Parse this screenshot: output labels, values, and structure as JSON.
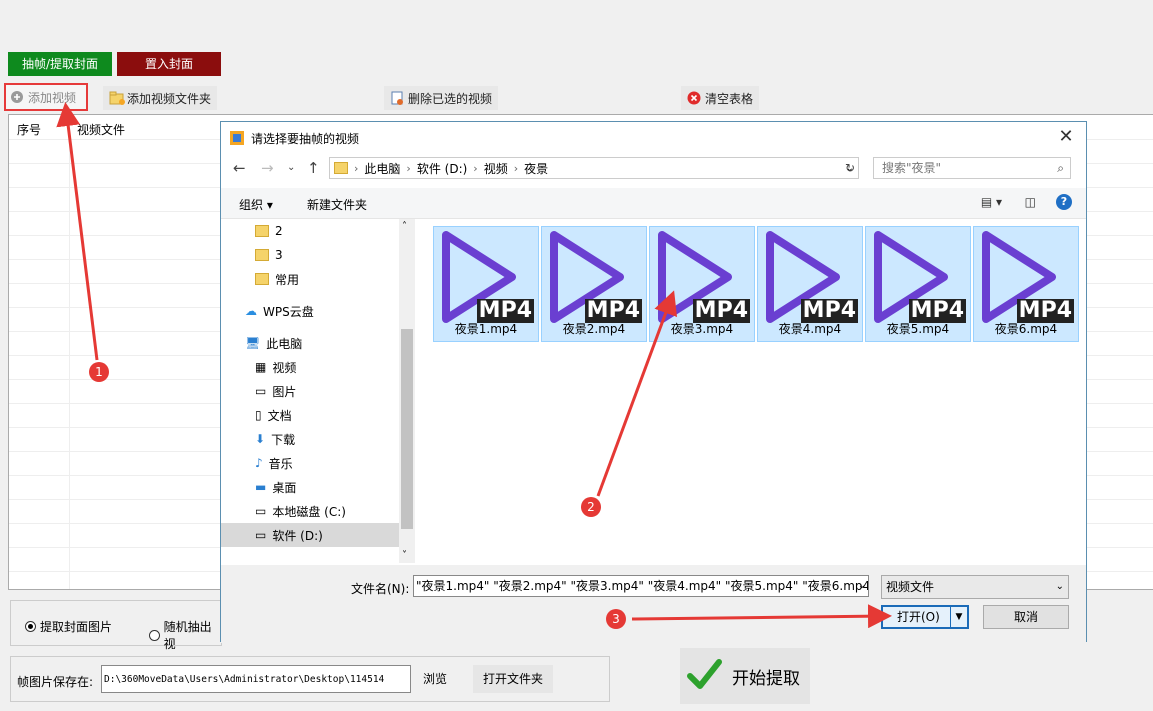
{
  "top_buttons": {
    "extract": "抽帧/提取封面",
    "insert": "置入封面"
  },
  "toolbar": {
    "add_video": "添加视频",
    "add_folder": "添加视频文件夹",
    "delete_selected": "删除已选的视频",
    "clear_table": "清空表格"
  },
  "grid": {
    "col_index": "序号",
    "col_file": "视频文件"
  },
  "options": {
    "extract_cover": "提取封面图片",
    "random_frame": "随机抽出视"
  },
  "save": {
    "label": "帧图片保存在:",
    "path": "D:\\360MoveData\\Users\\Administrator\\Desktop\\114514",
    "browse": "浏览",
    "open_folder": "打开文件夹"
  },
  "start_button": "开始提取",
  "dialog": {
    "title": "请选择要抽帧的视频",
    "close": "✕",
    "breadcrumb": [
      "此电脑",
      "软件 (D:)",
      "视频",
      "夜景"
    ],
    "search_placeholder": "搜索\"夜景\"",
    "organize": "组织",
    "new_folder": "新建文件夹",
    "help": "?",
    "nav_items": [
      {
        "label": "2",
        "icon": "folder-icon"
      },
      {
        "label": "3",
        "icon": "folder-icon"
      },
      {
        "label": "常用",
        "icon": "folder-icon"
      },
      {
        "label": "WPS云盘",
        "icon": "cloud-icon"
      },
      {
        "label": "此电脑",
        "icon": "computer-icon"
      },
      {
        "label": "视频",
        "icon": "video-icon"
      },
      {
        "label": "图片",
        "icon": "picture-icon"
      },
      {
        "label": "文档",
        "icon": "document-icon"
      },
      {
        "label": "下载",
        "icon": "download-icon"
      },
      {
        "label": "音乐",
        "icon": "music-icon"
      },
      {
        "label": "桌面",
        "icon": "desktop-icon"
      },
      {
        "label": "本地磁盘 (C:)",
        "icon": "drive-icon"
      },
      {
        "label": "软件 (D:)",
        "icon": "drive-icon"
      }
    ],
    "files": [
      {
        "name": "夜景1.mp4",
        "badge": "MP4"
      },
      {
        "name": "夜景2.mp4",
        "badge": "MP4"
      },
      {
        "name": "夜景3.mp4",
        "badge": "MP4"
      },
      {
        "name": "夜景4.mp4",
        "badge": "MP4"
      },
      {
        "name": "夜景5.mp4",
        "badge": "MP4"
      },
      {
        "name": "夜景6.mp4",
        "badge": "MP4"
      }
    ],
    "filename_label": "文件名(N):",
    "filename_value": "\"夜景1.mp4\" \"夜景2.mp4\" \"夜景3.mp4\" \"夜景4.mp4\" \"夜景5.mp4\" \"夜景6.mp4\"",
    "file_type": "视频文件",
    "open": "打开(O)",
    "cancel": "取消"
  },
  "annotations": [
    "1",
    "2",
    "3"
  ],
  "colors": {
    "annotation_red": "#e53935",
    "extract_green": "#0e8a1e",
    "insert_red": "#8b0d0d",
    "play_purple": "#6a3fd1",
    "selection_blue": "#cce8ff"
  }
}
